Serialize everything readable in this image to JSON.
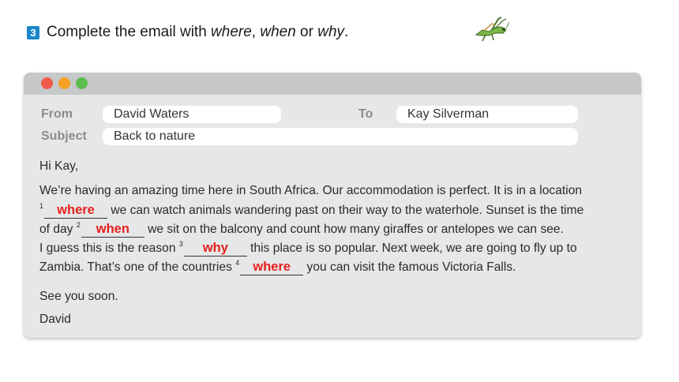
{
  "exercise": {
    "number": "3",
    "instruction_prefix": "Complete the email with ",
    "opt1": "where",
    "sep1": ", ",
    "opt2": "when",
    "sep2": " or ",
    "opt3": "why",
    "end": "."
  },
  "email": {
    "from_label": "From",
    "from_value": "David Waters",
    "to_label": "To",
    "to_value": "Kay Silverman",
    "subject_label": "Subject",
    "subject_value": "Back to nature",
    "greeting": "Hi Kay,",
    "line1": "We’re having an amazing time here in South Africa. Our accommodation is perfect. It is in a location",
    "n1": "1",
    "ans1": "where",
    "line2_rest": " we can watch animals wandering past on their way to the waterhole. Sunset is the time",
    "line3_pre": "of day ",
    "n2": "2",
    "ans2": "when",
    "line3_rest": " we sit on the balcony and count how many giraffes or antelopes we can see.",
    "line4_pre": "I guess this is the reason ",
    "n3": "3",
    "ans3": "why",
    "line4_rest": " this place is so popular. Next week, we are going to fly up to",
    "line5_pre": "Zambia. That’s one of the countries ",
    "n4": "4",
    "ans4": "where",
    "line5_rest": " you can visit the famous Victoria Falls.",
    "closing": "See you soon.",
    "signature": "David"
  },
  "colors": {
    "answer": "#e8201c",
    "exercise_badge": "#1c86c8",
    "window_bg": "#e6e7e8",
    "title_bar": "#c7c8ca"
  },
  "icons": {
    "insect": "grasshopper-icon"
  }
}
